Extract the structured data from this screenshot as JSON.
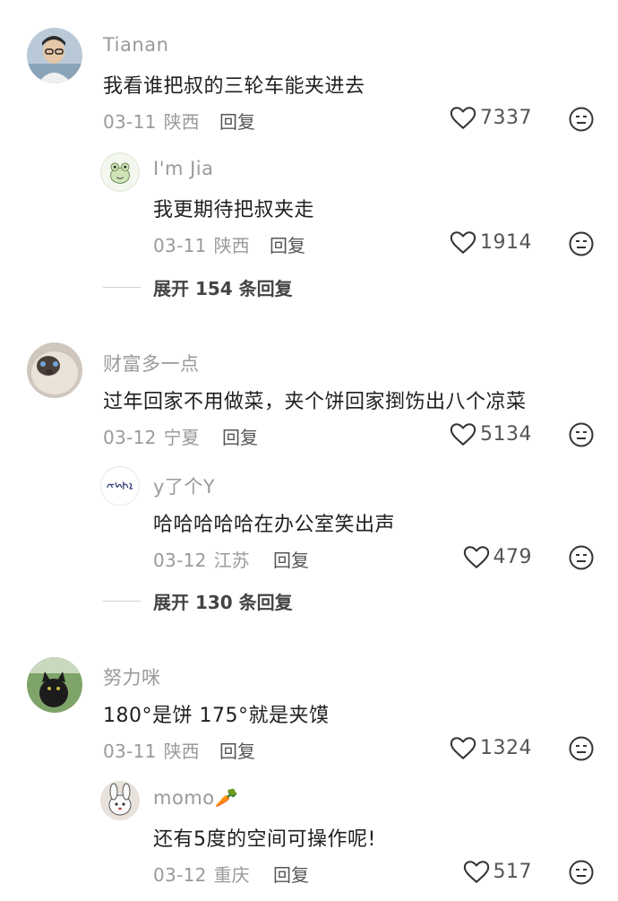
{
  "threads": [
    {
      "author": "Tianan",
      "text": "我看谁把叔的三轮车能夹进去",
      "date": "03-11",
      "location": "陕西",
      "reply_label": "回复",
      "likes": "7337",
      "reply": {
        "author": "I'm Jia",
        "text": "我更期待把叔夹走",
        "date": "03-11",
        "location": "陕西",
        "reply_label": "回复",
        "likes": "1914"
      },
      "expand": "展开 154 条回复"
    },
    {
      "author": "财富多一点",
      "text": "过年回家不用做菜，夹个饼回家捯饬出八个凉菜",
      "date": "03-12",
      "location": "宁夏",
      "reply_label": "回复",
      "likes": "5134",
      "reply": {
        "author": "y了个Y",
        "text": "哈哈哈哈哈在办公室笑出声",
        "date": "03-12",
        "location": "江苏",
        "reply_label": "回复",
        "likes": "479"
      },
      "expand": "展开 130 条回复"
    },
    {
      "author": "努力咪",
      "text": "180°是饼 175°就是夹馍",
      "date": "03-11",
      "location": "陕西",
      "reply_label": "回复",
      "likes": "1324",
      "reply": {
        "author": "momo🥕",
        "text": "还有5度的空间可操作呢!",
        "date": "03-12",
        "location": "重庆",
        "reply_label": "回复",
        "likes": "517"
      }
    }
  ],
  "icons": {
    "like": "heart-outline-icon",
    "dislike": "neutral-face-icon"
  },
  "colors": {
    "meta_gray": "#9a9a9a",
    "text_dark": "#1f1f1f"
  }
}
